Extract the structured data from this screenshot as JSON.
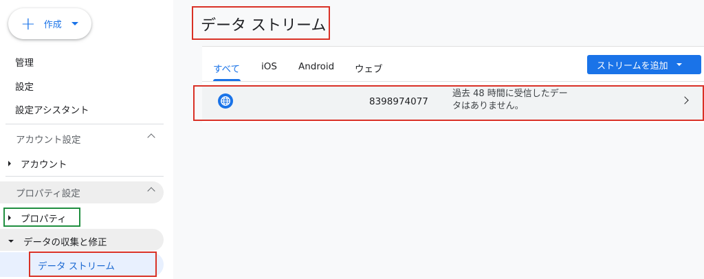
{
  "sidebar": {
    "create_label": "作成",
    "items": [
      "管理",
      "設定",
      "設定アシスタント"
    ],
    "account_section": "アカウント設定",
    "account_item": "アカウント",
    "property_section": "プロパティ設定",
    "property_item": "プロパティ",
    "data_collection_item": "データの収集と修正",
    "data_streams_item": "データ ストリーム"
  },
  "main": {
    "title": "データ ストリーム",
    "tabs": [
      "すべて",
      "iOS",
      "Android",
      "ウェブ"
    ],
    "active_tab": "すべて",
    "add_stream_label": "ストリームを追加",
    "stream_row": {
      "icon": "web-globe-icon",
      "id": "8398974077",
      "status": "過去 48 時間に受信したデータはありません。"
    }
  },
  "colors": {
    "accent": "#1a73e8",
    "highlight_red": "#d93025",
    "highlight_green": "#1e8e3e"
  }
}
